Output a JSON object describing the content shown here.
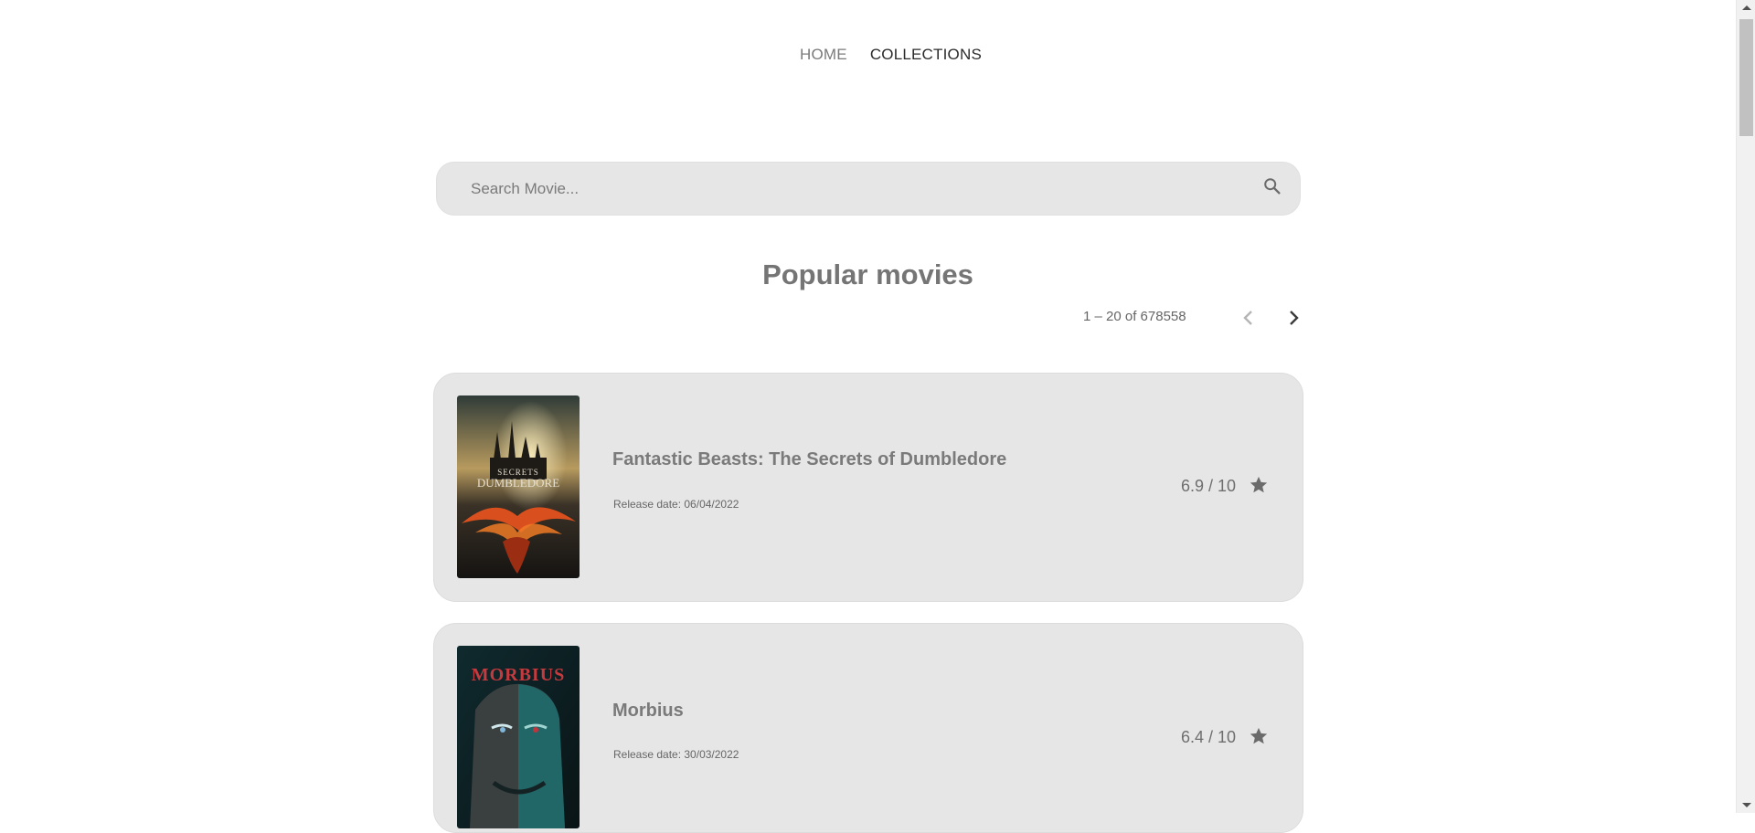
{
  "nav": {
    "home_label": "HOME",
    "collections_label": "COLLECTIONS"
  },
  "search": {
    "placeholder": "Search Movie...",
    "value": ""
  },
  "section": {
    "title": "Popular movies"
  },
  "pagination": {
    "range": "1 – 20 of 678558"
  },
  "movies": [
    {
      "title": "Fantastic Beasts: The Secrets of Dumbledore",
      "release": "Release date: 06/04/2022",
      "rating": "6.9 / 10",
      "poster_text_1": "SECRETS",
      "poster_text_2": "DUMBLEDORE"
    },
    {
      "title": "Morbius",
      "release": "Release date: 30/03/2022",
      "rating": "6.4 / 10",
      "poster_text_1": "MORBIUS"
    }
  ],
  "icons": {
    "search": "search-icon",
    "prev": "chevron-left-icon",
    "next": "chevron-right-icon",
    "star": "star-icon"
  },
  "colors": {
    "card_bg": "#e6e6e6",
    "text_muted": "#757575"
  }
}
